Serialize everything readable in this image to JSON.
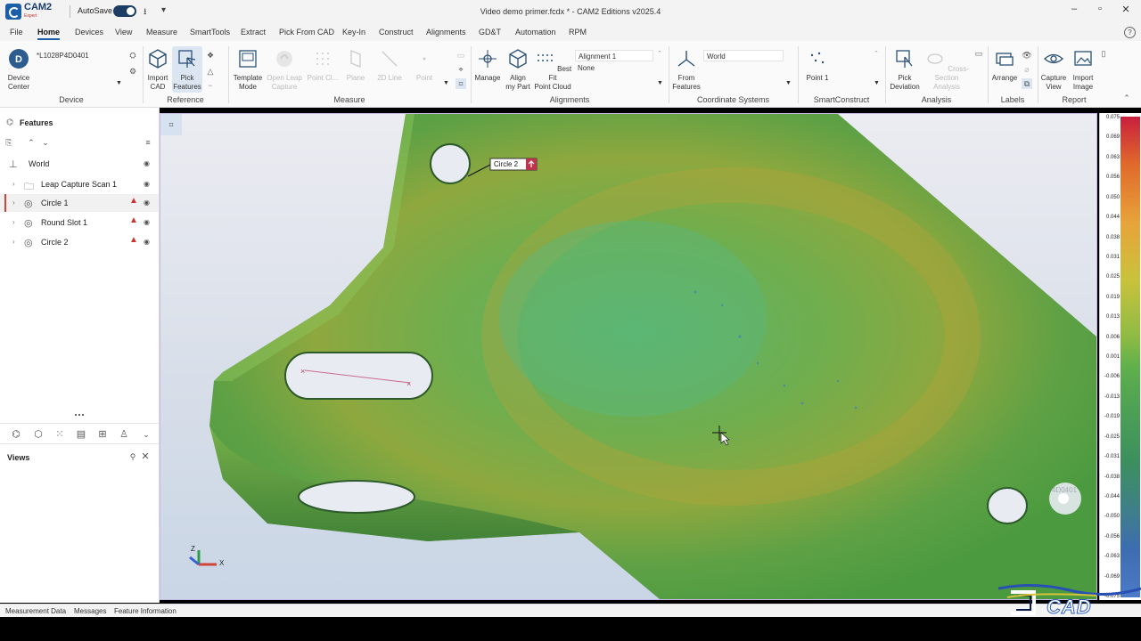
{
  "app": {
    "logo_text": "CAM2",
    "logo_sub": "Expert",
    "autosave_label": "AutoSave",
    "window_title": "Video demo primer.fcdx * - CAM2 Editions v2025.4"
  },
  "menu": [
    "File",
    "Home",
    "Devices",
    "View",
    "Measure",
    "SmartTools",
    "Extract",
    "Pick From CAD",
    "Key-In",
    "Construct",
    "Alignments",
    "GD&T",
    "Automation",
    "RPM"
  ],
  "ribbon": {
    "device": {
      "center_label": "Device\nCenter",
      "device_id": "*L1028P4D0401",
      "group": "Device"
    },
    "reference": {
      "import_cad": "Import\nCAD",
      "pick_features": "Pick\nFeatures",
      "group": "Reference"
    },
    "measure": {
      "template_mode": "Template\nMode",
      "open_leap_capture": "Open Leap\nCapture",
      "point_cloud": "Point Cl...",
      "plane": "Plane",
      "line_2d": "2D Line",
      "point": "Point",
      "group": "Measure"
    },
    "alignments": {
      "manage": "Manage",
      "align_part": "Align\nmy Part",
      "best_fit": "Best Fit\nPoint Cloud",
      "alignment_list": [
        "Alignment 1",
        "None"
      ],
      "group": "Alignments"
    },
    "coordinate_systems": {
      "from_features": "From\nFeatures",
      "selected": "World",
      "group": "Coordinate Systems"
    },
    "smartconstruct": {
      "point": "Point 1",
      "group": "SmartConstruct"
    },
    "analysis": {
      "pick_deviation": "Pick\nDeviation",
      "cross_section": "Cross-Section\nAnalysis",
      "group": "Analysis"
    },
    "labels": {
      "arrange": "Arrange",
      "group": "Labels"
    },
    "report": {
      "capture_view": "Capture\nView",
      "import_image": "Import\nImage",
      "group": "Report"
    }
  },
  "features_panel": {
    "title": "Features",
    "items": [
      {
        "label": "World",
        "icon": "axis-icon",
        "warn": false
      },
      {
        "label": "Leap Capture Scan 1",
        "icon": "folder-icon",
        "warn": false
      },
      {
        "label": "Circle 1",
        "icon": "circle-feature-icon",
        "warn": true
      },
      {
        "label": "Round Slot 1",
        "icon": "slot-feature-icon",
        "warn": true
      },
      {
        "label": "Circle 2",
        "icon": "circle-feature-icon",
        "warn": true
      }
    ],
    "views_title": "Views"
  },
  "viewport": {
    "circle_label": "Circle 2",
    "part_label": "4D0401",
    "axis_x": "X",
    "axis_z": "Z"
  },
  "color_scale": [
    "0.075",
    "0.069",
    "0.063",
    "0.056",
    "0.050",
    "0.044",
    "0.038",
    "0.031",
    "0.025",
    "0.019",
    "0.013",
    "0.006",
    "0.001",
    "-0.006",
    "-0.013",
    "-0.019",
    "-0.025",
    "-0.031",
    "-0.038",
    "-0.044",
    "-0.050",
    "-0.056",
    "-0.063",
    "-0.069",
    "-0.075"
  ],
  "status_tabs": [
    "Measurement Data",
    "Messages",
    "Feature Information"
  ],
  "watermark": "CAD"
}
